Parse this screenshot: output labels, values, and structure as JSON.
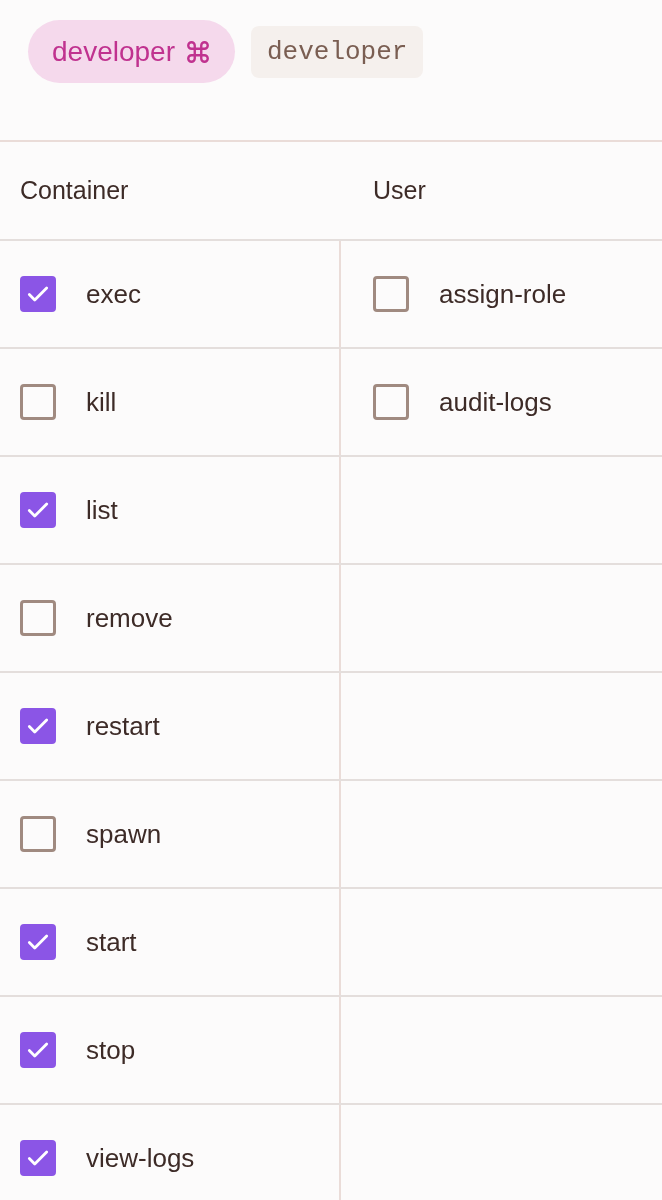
{
  "role_badge": {
    "label": "developer"
  },
  "role_code": "developer",
  "columns": [
    {
      "title": "Container",
      "permissions": [
        {
          "label": "exec",
          "checked": true
        },
        {
          "label": "kill",
          "checked": false
        },
        {
          "label": "list",
          "checked": true
        },
        {
          "label": "remove",
          "checked": false
        },
        {
          "label": "restart",
          "checked": true
        },
        {
          "label": "spawn",
          "checked": false
        },
        {
          "label": "start",
          "checked": true
        },
        {
          "label": "stop",
          "checked": true
        },
        {
          "label": "view-logs",
          "checked": true
        }
      ]
    },
    {
      "title": "User",
      "permissions": [
        {
          "label": "assign-role",
          "checked": false
        },
        {
          "label": "audit-logs",
          "checked": false
        }
      ]
    }
  ]
}
